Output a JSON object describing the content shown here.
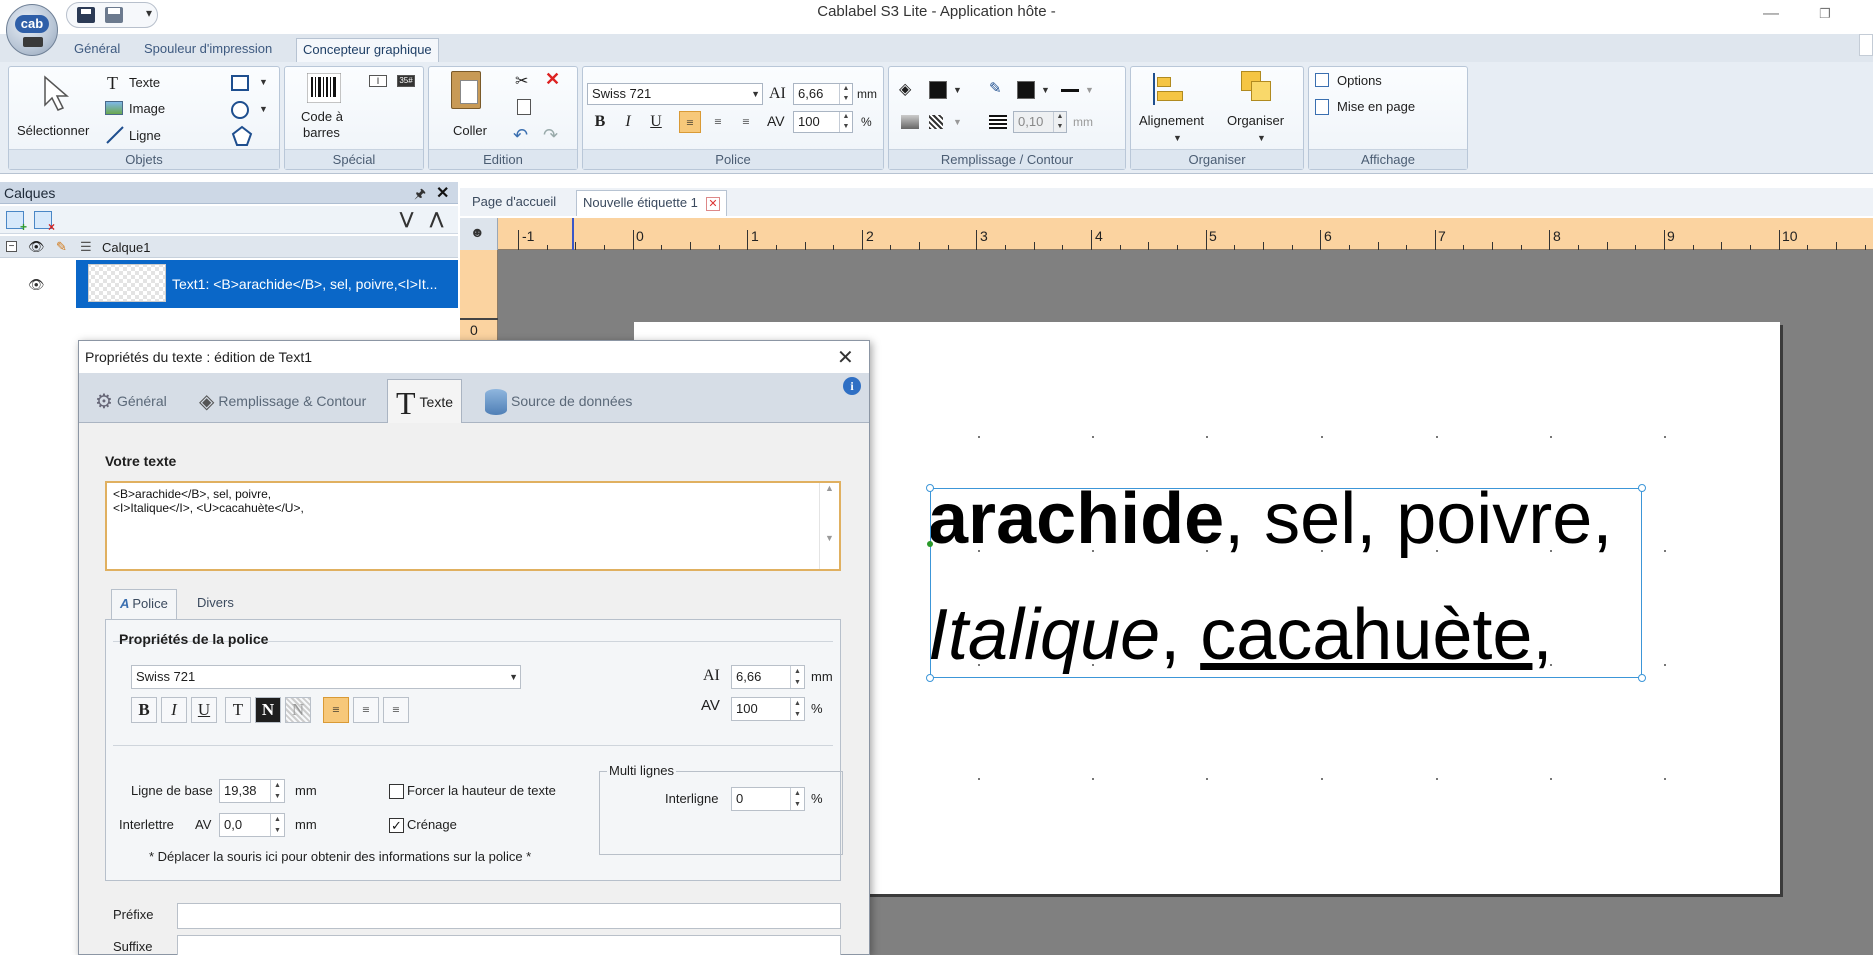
{
  "window": {
    "title": "Cablabel S3 Lite  - Application hôte -",
    "logo_text": "cab",
    "minimize_icon": "minimize-icon",
    "maximize_icon": "restore-icon"
  },
  "quick_access": {
    "dropdown": "▾"
  },
  "ribbon_tabs": [
    "Général",
    "Spouleur d'impression",
    "Concepteur graphique"
  ],
  "ribbon": {
    "objects": {
      "label": "Objets",
      "select": "Sélectionner",
      "text": "Texte",
      "image": "Image",
      "line": "Ligne"
    },
    "special": {
      "label": "Spécial",
      "barcode_line1": "Code à",
      "barcode_line2": "barres"
    },
    "edition": {
      "label": "Edition",
      "paste": "Coller"
    },
    "font": {
      "label": "Police",
      "font_name": "Swiss 721",
      "size": "6,66",
      "size_unit": "mm",
      "width": "100",
      "width_unit": "%"
    },
    "fill": {
      "label": "Remplissage / Contour",
      "line_width": "0,10",
      "line_unit": "mm"
    },
    "organize": {
      "label": "Organiser",
      "align": "Alignement",
      "arrange": "Organiser"
    },
    "display": {
      "label": "Affichage",
      "options": "Options",
      "page_setup": "Mise en page"
    }
  },
  "layers": {
    "title": "Calques",
    "layer_name": "Calque1",
    "object_label": "Text1: <B>arachide</B>, sel, poivre,<I>It..."
  },
  "doc_tabs": [
    "Page d'accueil",
    "Nouvelle étiquette 1"
  ],
  "ruler": {
    "h_labels": [
      "-1",
      "0",
      "1",
      "2",
      "3",
      "4",
      "5",
      "6",
      "7",
      "8",
      "9",
      "10"
    ],
    "v_label": "0"
  },
  "label": {
    "line1_bold": "arachide",
    "line1_rest": ", sel, poivre,",
    "line2_italic": "Italique",
    "line2_sep": ", ",
    "line2_underline": "cacahuète",
    "line2_end": ","
  },
  "dialog": {
    "title": "Propriétés du texte : édition de Text1",
    "tabs": [
      "Général",
      "Remplissage & Contour",
      "Texte",
      "Source de données"
    ],
    "your_text_label": "Votre texte",
    "text_value": "<B>arachide</B>, sel, poivre,\n<I>Italique</I>, <U>cacahuète</U>,",
    "subtabs": [
      "Police",
      "Divers"
    ],
    "font_props_title": "Propriétés de la police",
    "font_name": "Swiss 721",
    "size": "6,66",
    "size_unit": "mm",
    "width": "100",
    "width_unit": "%",
    "baseline_label": "Ligne de base",
    "baseline_value": "19,38",
    "baseline_unit": "mm",
    "spacing_label": "Interlettre",
    "spacing_value": "0,0",
    "spacing_unit": "mm",
    "force_height_label": "Forcer la hauteur de texte",
    "force_height_checked": false,
    "kerning_label": "Crénage",
    "kerning_checked": true,
    "multiline_title": "Multi lignes",
    "interline_label": "Interligne",
    "interline_value": "0",
    "interline_unit": "%",
    "hint": "* Déplacer la souris ici pour obtenir des informations sur la police *",
    "prefix_label": "Préfixe",
    "suffix_label": "Suffixe"
  },
  "colors": {
    "ribbon_bg": "#e7edf4",
    "ruler": "#fbd3a0",
    "selection": "#0a67c8",
    "canvas": "#808080",
    "active_button": "#f7c87a"
  }
}
